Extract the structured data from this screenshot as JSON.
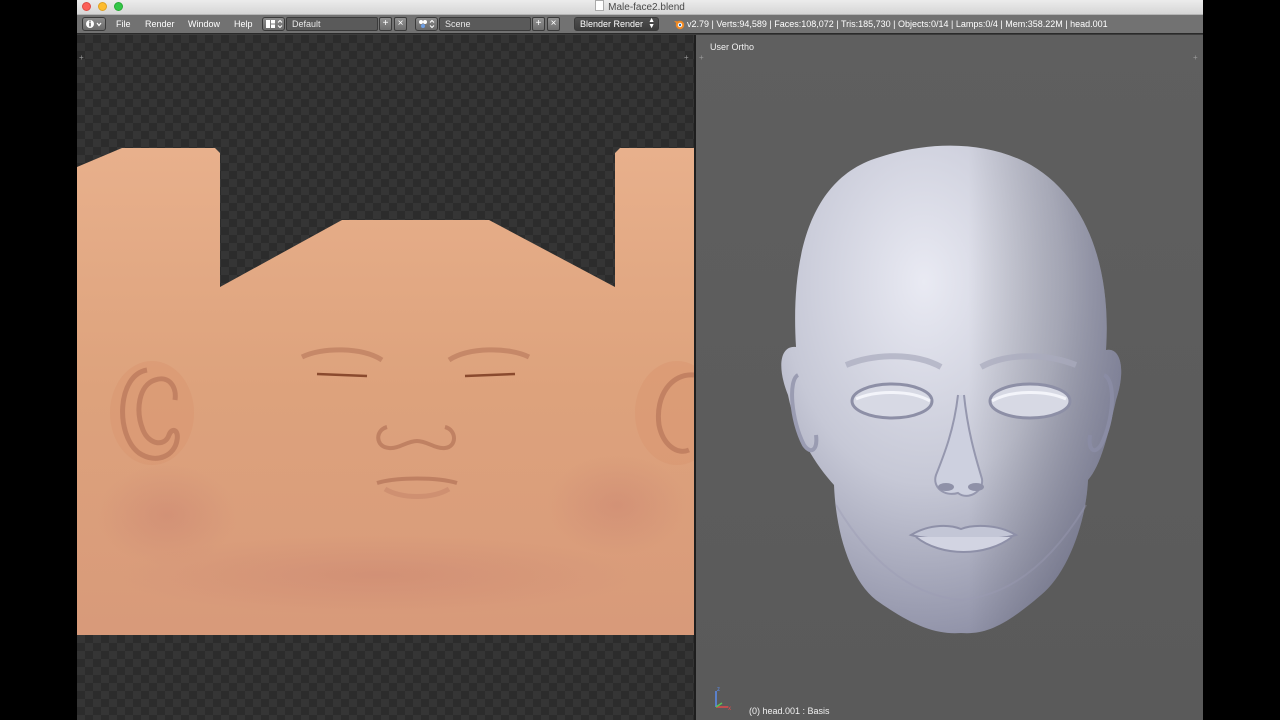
{
  "window": {
    "title": "Male-face2.blend"
  },
  "header": {
    "menus": [
      "File",
      "Render",
      "Window",
      "Help"
    ],
    "screen_layout": "Default",
    "scene": "Scene",
    "render_engine": "Blender Render",
    "stats": "v2.79 | Verts:94,589 | Faces:108,072 | Tris:185,730 | Objects:0/14 | Lamps:0/4 | Mem:358.22M | head.001"
  },
  "viewport": {
    "view_name": "User Ortho",
    "object_info": "(0) head.001 : Basis"
  },
  "icons": {
    "info": "info-icon",
    "layout": "screen-layout-icon",
    "scene": "scene-icon",
    "blender": "blender-logo-icon",
    "add": "plus-icon",
    "remove": "close-icon"
  },
  "colors": {
    "header_bg": "#727272",
    "viewport_bg": "#5c5c5c",
    "uv_bg": "#2c2c2c",
    "skin": "#e0a680",
    "mesh": "#c9cbd8"
  }
}
